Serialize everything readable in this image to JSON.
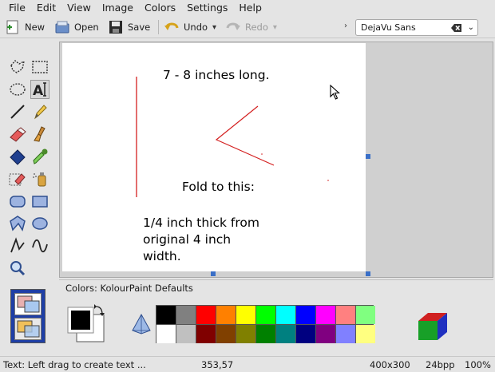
{
  "menubar": {
    "items": [
      "File",
      "Edit",
      "View",
      "Image",
      "Colors",
      "Settings",
      "Help"
    ]
  },
  "toolbar": {
    "new_label": "New",
    "open_label": "Open",
    "save_label": "Save",
    "undo_label": "Undo",
    "redo_label": "Redo",
    "font_family": "DejaVu Sans"
  },
  "canvas": {
    "line1": "7 - 8 inches long.",
    "line2": "Fold to this:",
    "line3a": "1/4 inch thick from",
    "line3b": "original 4 inch",
    "line3c": "width."
  },
  "colors": {
    "title": "Colors: KolourPaint Defaults",
    "foreground": "#000000",
    "background": "#ffffff",
    "palette_row1": [
      "#000000",
      "#808080",
      "#ff0000",
      "#ff8000",
      "#ffff00",
      "#00ff00",
      "#00ffff",
      "#0000ff",
      "#ff00ff",
      "#ff8080",
      "#80ff80"
    ],
    "palette_row2": [
      "#ffffff",
      "#c0c0c0",
      "#800000",
      "#804000",
      "#808000",
      "#008000",
      "#008080",
      "#000080",
      "#800080",
      "#8080ff",
      "#ffff80"
    ]
  },
  "statusbar": {
    "message": "Text: Left drag to create text ...",
    "coords": "353,57",
    "size": "400x300",
    "depth": "24bpp",
    "zoom": "100%"
  }
}
